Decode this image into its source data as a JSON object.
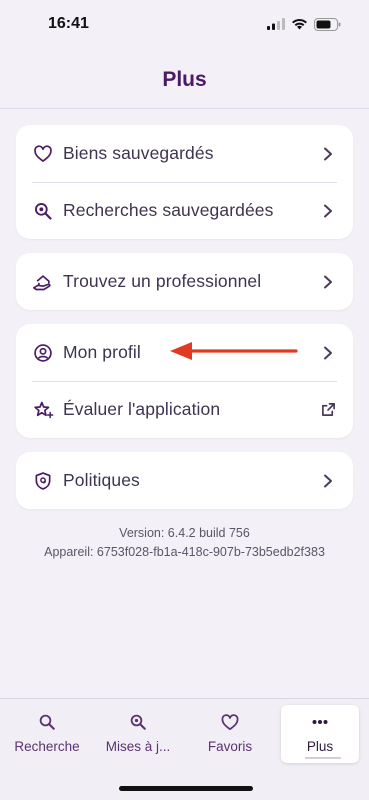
{
  "status_bar": {
    "time": "16:41"
  },
  "header": {
    "title": "Plus"
  },
  "cards": [
    {
      "rows": [
        {
          "label": "Biens sauvegardés",
          "icon": "heart-icon",
          "trail": "chevron-right-icon"
        },
        {
          "label": "Recherches sauvegardées",
          "icon": "search-saved-icon",
          "trail": "chevron-right-icon"
        }
      ]
    },
    {
      "rows": [
        {
          "label": "Trouvez un professionnel",
          "icon": "hand-house-icon",
          "trail": "chevron-right-icon"
        }
      ]
    },
    {
      "rows": [
        {
          "label": "Mon profil",
          "icon": "user-circle-icon",
          "trail": "chevron-right-icon"
        },
        {
          "label": "Évaluer l'application",
          "icon": "star-sparkle-icon",
          "trail": "external-link-icon"
        }
      ]
    },
    {
      "rows": [
        {
          "label": "Politiques",
          "icon": "shield-icon",
          "trail": "chevron-right-icon"
        }
      ]
    }
  ],
  "version_info": {
    "version": "Version: 6.4.2 build 756",
    "device": "Appareil: 6753f028-fb1a-418c-907b-73b5edb2f383"
  },
  "tabbar": {
    "tabs": [
      {
        "label": "Recherche",
        "icon": "search-icon"
      },
      {
        "label": "Mises à j...",
        "icon": "search-update-icon"
      },
      {
        "label": "Favoris",
        "icon": "heart-icon"
      },
      {
        "label": "Plus",
        "icon": "more-dots-icon",
        "active": true
      }
    ]
  },
  "colors": {
    "accent": "#4a1a66",
    "background": "#f3f1f7",
    "arrow": "#e23a22"
  }
}
